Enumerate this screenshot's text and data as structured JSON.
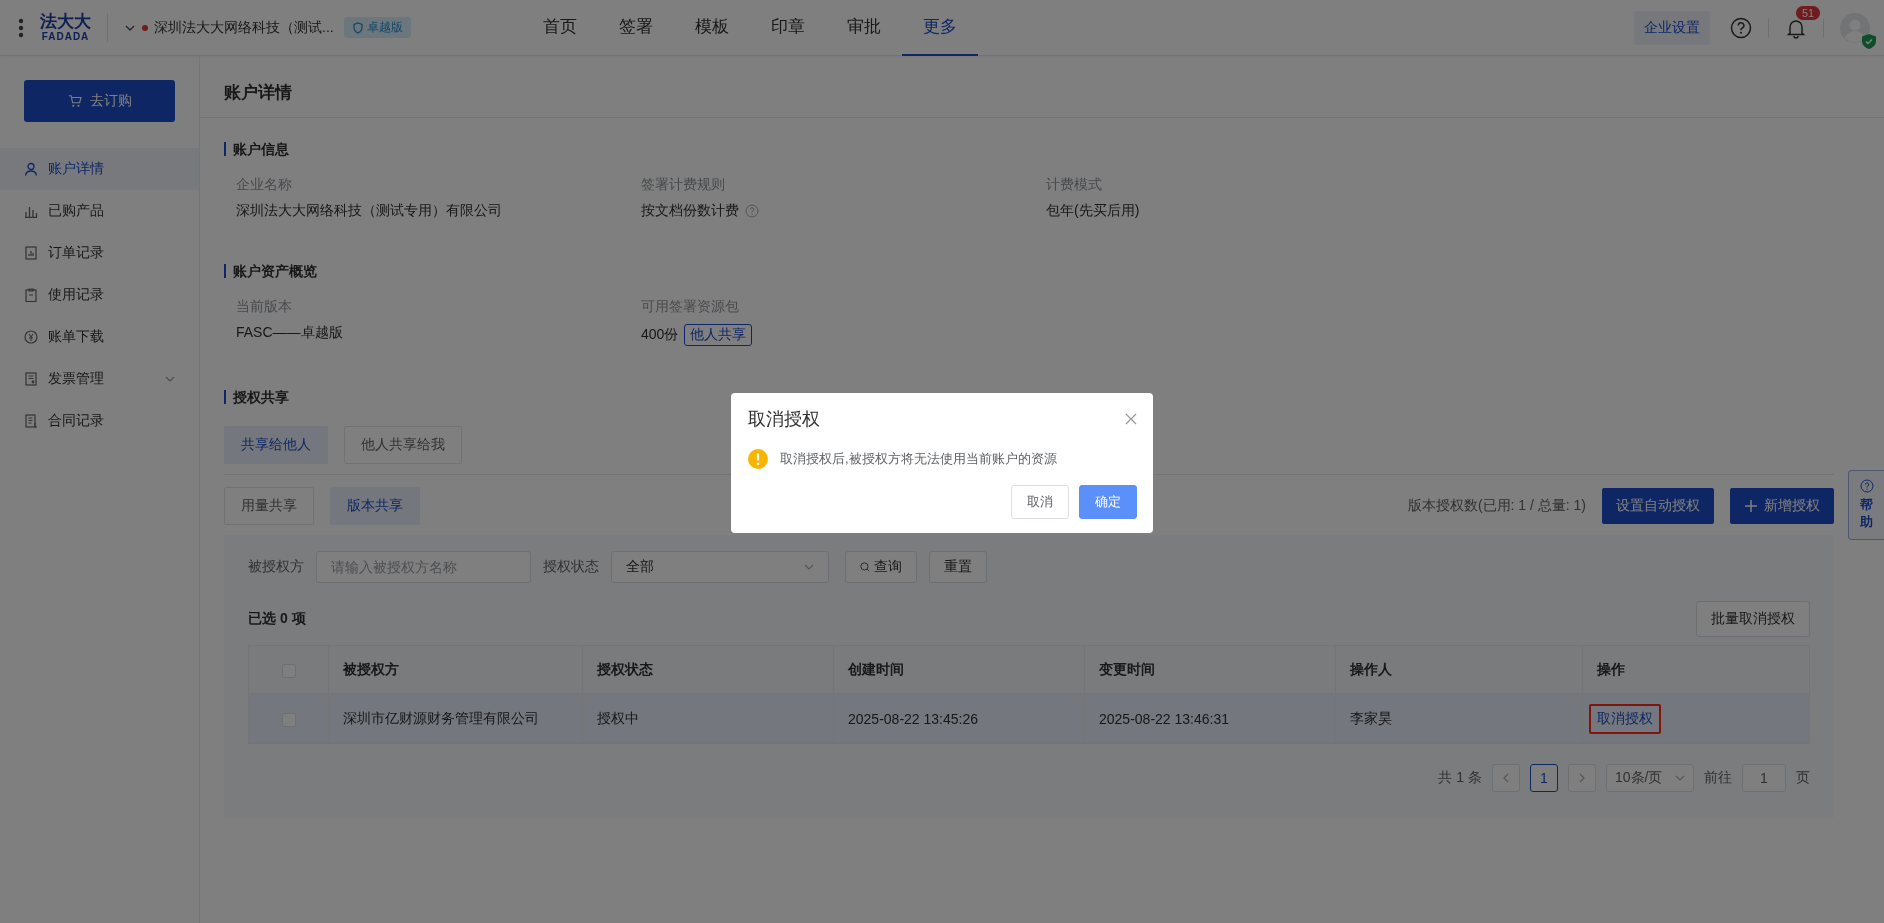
{
  "header": {
    "logo": {
      "cn": "法大大",
      "en": "FADADA"
    },
    "company": "深圳法大大网络科技（测试...",
    "edition_badge": "卓越版",
    "nav": [
      {
        "label": "首页",
        "selected": false
      },
      {
        "label": "签署",
        "selected": false
      },
      {
        "label": "模板",
        "selected": false
      },
      {
        "label": "印章",
        "selected": false
      },
      {
        "label": "审批",
        "selected": false
      },
      {
        "label": "更多",
        "selected": true
      }
    ],
    "settings_button": "企业设置",
    "notification_count": "51"
  },
  "sidebar": {
    "order_button": "去订购",
    "items": [
      {
        "label": "账户详情",
        "selected": true
      },
      {
        "label": "已购产品",
        "selected": false
      },
      {
        "label": "订单记录",
        "selected": false
      },
      {
        "label": "使用记录",
        "selected": false
      },
      {
        "label": "账单下载",
        "selected": false
      },
      {
        "label": "发票管理",
        "selected": false,
        "expandable": true
      },
      {
        "label": "合同记录",
        "selected": false
      }
    ]
  },
  "page_title": "账户详情",
  "sections": [
    {
      "title": "账户信息",
      "fields": [
        {
          "label": "企业名称",
          "value": "深圳法大大网络科技（测试专用）有限公司"
        },
        {
          "label": "签署计费规则",
          "value": "按文档份数计费",
          "help": true
        },
        {
          "label": "计费模式",
          "value": "包年(先买后用)"
        }
      ]
    },
    {
      "title": "账户资产概览",
      "fields": [
        {
          "label": "当前版本",
          "value": "FASC——卓越版"
        },
        {
          "label": "可用签署资源包",
          "value": "400份",
          "tag": "他人共享"
        }
      ]
    }
  ],
  "sharing": {
    "title": "授权共享",
    "tabs": [
      {
        "label": "共享给他人",
        "selected": true
      },
      {
        "label": "他人共享给我",
        "selected": false
      }
    ],
    "subtabs": [
      {
        "label": "用量共享",
        "selected": false
      },
      {
        "label": "版本共享",
        "selected": true
      }
    ],
    "quota_text": "版本授权数(已用: 1 / 总量: 1)",
    "auto_button": "设置自动授权",
    "add_button": "新增授权",
    "filter": {
      "grantee_label": "被授权方",
      "grantee_placeholder": "请输入被授权方名称",
      "status_label": "授权状态",
      "status_value": "全部",
      "search_button": "查询",
      "reset_button": "重置"
    },
    "selected_count": "已选 0 项",
    "batch_button": "批量取消授权",
    "table": {
      "all_checked": false,
      "columns": [
        "被授权方",
        "授权状态",
        "创建时间",
        "变更时间",
        "操作人",
        "操作"
      ],
      "rows": [
        {
          "checked": false,
          "highlighted": true,
          "cells": [
            "深圳市亿财源财务管理有限公司",
            "授权中",
            "2025-08-22 13:45:26",
            "2025-08-22 13:46:31",
            "李家昊"
          ],
          "action": "取消授权",
          "annotated": true
        }
      ]
    },
    "pagination": {
      "total": "共 1 条",
      "pages": [
        {
          "label": "1",
          "selected": true
        }
      ],
      "page_size": "10条/页",
      "goto_label": "前往",
      "goto_value": "1",
      "page_unit": "页"
    }
  },
  "help_tab": "帮助",
  "dialog": {
    "title": "取消授权",
    "message": "取消授权后,被授权方将无法使用当前账户的资源",
    "cancel_button": "取消",
    "confirm_button": "确定"
  }
}
